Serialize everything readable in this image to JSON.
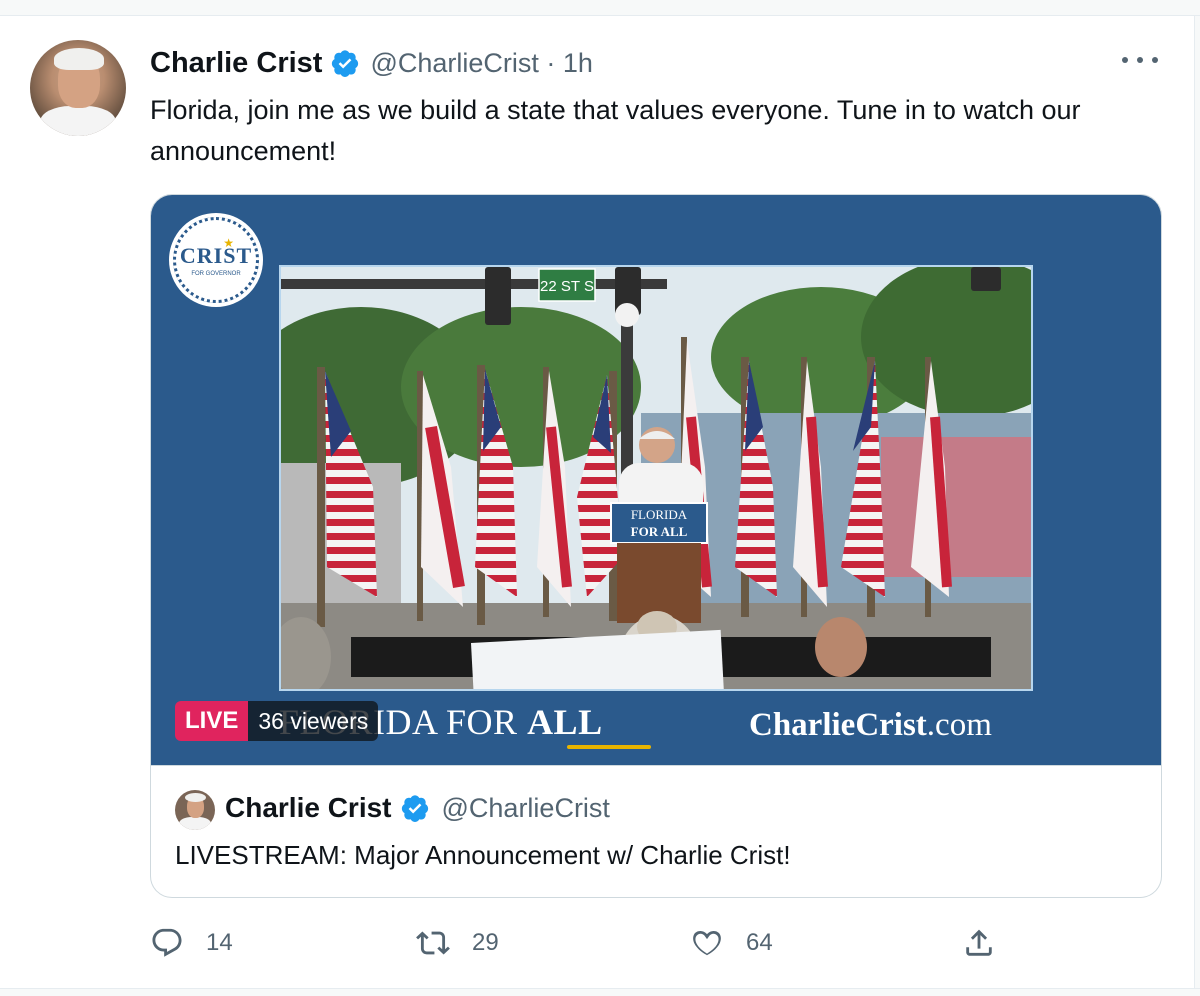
{
  "tweet": {
    "author_name": "Charlie Crist",
    "author_handle_time": "@CharlieCrist · 1h",
    "text": "Florida, join me as we build a state that values everyone. Tune in to watch our announcement!"
  },
  "media": {
    "logo_text": "CRIST",
    "logo_subtext": "FOR GOVERNOR",
    "live_label": "LIVE",
    "viewers": "36 viewers",
    "banner_left_prefix": "FLORIDA FOR ",
    "banner_left_bold": "ALL",
    "banner_right_bold": "CharlieCrist",
    "banner_right_rest": ".com",
    "street_sign": "22 ST S",
    "podium_line1": "FLORIDA",
    "podium_line2": "FOR ALL"
  },
  "quoted": {
    "author_name": "Charlie Crist",
    "author_handle": "@CharlieCrist",
    "text": "LIVESTREAM: Major Announcement w/ Charlie Crist!"
  },
  "actions": {
    "reply_count": "14",
    "retweet_count": "29",
    "like_count": "64"
  },
  "colors": {
    "accent": "#1d9bf0",
    "live": "#e0245e",
    "media_bg": "#2b5a8c",
    "secondary_text": "#536471"
  },
  "icons": [
    "verified-badge-icon",
    "more-icon",
    "reply-icon",
    "retweet-icon",
    "like-icon",
    "share-icon"
  ]
}
